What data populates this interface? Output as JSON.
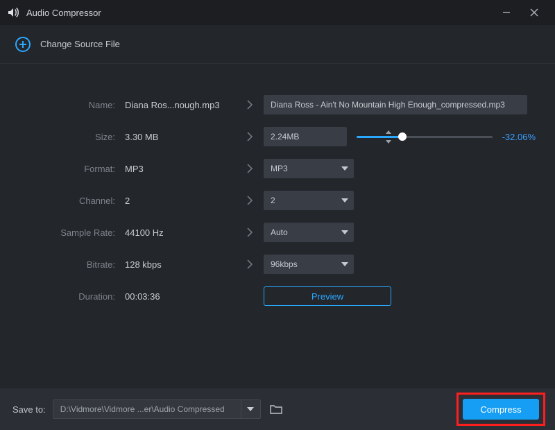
{
  "titlebar": {
    "title": "Audio Compressor"
  },
  "source": {
    "change_label": "Change Source File"
  },
  "labels": {
    "name": "Name:",
    "size": "Size:",
    "format": "Format:",
    "channel": "Channel:",
    "sample_rate": "Sample Rate:",
    "bitrate": "Bitrate:",
    "duration": "Duration:"
  },
  "original": {
    "name": "Diana Ros...nough.mp3",
    "size": "3.30 MB",
    "format": "MP3",
    "channel": "2",
    "sample_rate": "44100 Hz",
    "bitrate": "128 kbps",
    "duration": "00:03:36"
  },
  "target": {
    "name": "Diana Ross - Ain't No Mountain High Enough_compressed.mp3",
    "size": "2.24MB",
    "size_pct": "-32.06%",
    "format": "MP3",
    "channel": "2",
    "sample_rate": "Auto",
    "bitrate": "96kbps"
  },
  "buttons": {
    "preview": "Preview",
    "compress": "Compress"
  },
  "save": {
    "label": "Save to:",
    "path": "D:\\Vidmore\\Vidmore ...er\\Audio Compressed"
  }
}
